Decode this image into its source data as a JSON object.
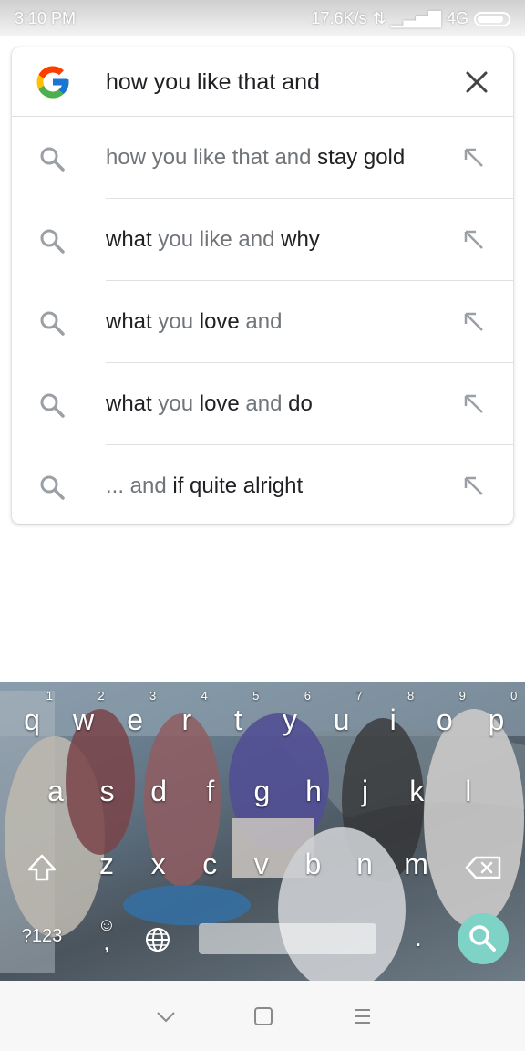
{
  "status_bar": {
    "time": "3:10 PM",
    "network_speed": "17.6K/s",
    "network_type": "4G"
  },
  "search": {
    "query": "how you like that and"
  },
  "suggestions": [
    {
      "parts": [
        {
          "text": "how you like that and ",
          "style": "muted"
        },
        {
          "text": "stay gold",
          "style": "strong"
        }
      ]
    },
    {
      "parts": [
        {
          "text": "what",
          "style": "strong"
        },
        {
          "text": " you like and ",
          "style": "muted"
        },
        {
          "text": "why",
          "style": "strong"
        }
      ]
    },
    {
      "parts": [
        {
          "text": "what",
          "style": "strong"
        },
        {
          "text": " you ",
          "style": "muted"
        },
        {
          "text": "love",
          "style": "strong"
        },
        {
          "text": " and",
          "style": "muted"
        }
      ]
    },
    {
      "parts": [
        {
          "text": "what",
          "style": "strong"
        },
        {
          "text": " you ",
          "style": "muted"
        },
        {
          "text": "love",
          "style": "strong"
        },
        {
          "text": " and ",
          "style": "muted"
        },
        {
          "text": "do",
          "style": "strong"
        }
      ]
    },
    {
      "parts": [
        {
          "text": "... and ",
          "style": "muted"
        },
        {
          "text": "if quite alright",
          "style": "strong"
        }
      ]
    }
  ],
  "keyboard": {
    "row1": [
      {
        "key": "q",
        "hint": "1"
      },
      {
        "key": "w",
        "hint": "2"
      },
      {
        "key": "e",
        "hint": "3"
      },
      {
        "key": "r",
        "hint": "4"
      },
      {
        "key": "t",
        "hint": "5"
      },
      {
        "key": "y",
        "hint": "6"
      },
      {
        "key": "u",
        "hint": "7"
      },
      {
        "key": "i",
        "hint": "8"
      },
      {
        "key": "o",
        "hint": "9"
      },
      {
        "key": "p",
        "hint": "0"
      }
    ],
    "row2": [
      "a",
      "s",
      "d",
      "f",
      "g",
      "h",
      "j",
      "k",
      "l"
    ],
    "row3": [
      "z",
      "x",
      "c",
      "v",
      "b",
      "n",
      "m"
    ],
    "symbols_label": "?123",
    "comma": ",",
    "period": "."
  },
  "colors": {
    "search_key": "#7fd2c6",
    "muted_text": "#70757a",
    "strong_text": "#202124"
  }
}
